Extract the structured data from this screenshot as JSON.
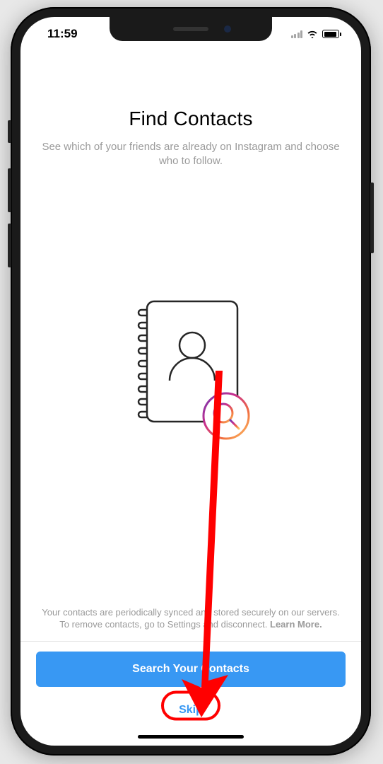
{
  "status": {
    "time": "11:59"
  },
  "header": {
    "title": "Find Contacts",
    "subtitle": "See which of your friends are already on Instagram and choose who to follow."
  },
  "disclaimer": {
    "text_before": "Your contacts are periodically synced and stored securely on our servers. To remove contacts, go to Settings and disconnect. ",
    "learn_more": "Learn More.",
    "text_after": ""
  },
  "buttons": {
    "primary": "Search Your Contacts",
    "skip": "Skip"
  },
  "colors": {
    "primary": "#3898f3",
    "annotation": "#ff0000"
  },
  "icons": {
    "illustration": "contact-book-search-icon",
    "signal": "cellular-signal-icon",
    "wifi": "wifi-icon",
    "battery": "battery-icon"
  }
}
